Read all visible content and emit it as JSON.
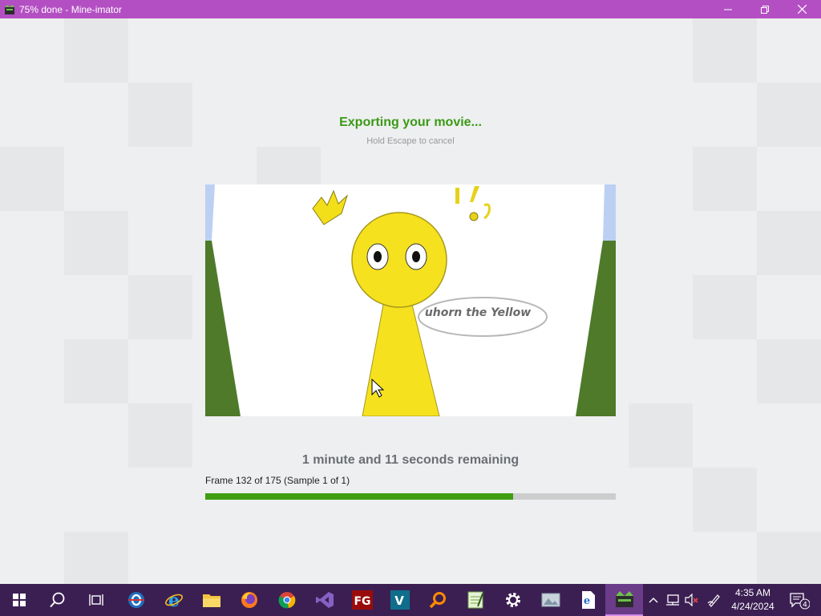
{
  "window": {
    "title": "75% done - Mine-imator",
    "controls": {
      "minimize": "minimize-icon",
      "maximize": "restore-icon",
      "close": "close-icon"
    }
  },
  "export": {
    "heading": "Exporting your movie...",
    "subheading": "Hold Escape to cancel",
    "preview_caption": "uhorn the Yellow",
    "remaining": "1 minute and 11 seconds remaining",
    "frame_status": "Frame 132 of 175 (Sample 1 of 1)",
    "progress": 0.75
  },
  "taskbar": {
    "apps": [
      "windows-start-icon",
      "search-icon",
      "task-view-icon",
      "outlook-icon",
      "internet-explorer-icon",
      "file-explorer-icon",
      "firefox-icon",
      "chrome-icon",
      "visual-studio-icon",
      "fg-app-icon",
      "vegas-icon",
      "search-tool-icon",
      "notepad-icon",
      "settings-icon",
      "photo-viewer-icon",
      "document-icon",
      "mine-imator-icon"
    ],
    "tray_icons": [
      "chevron-up-icon",
      "network-icon",
      "volume-muted-icon",
      "pen-icon"
    ],
    "clock": {
      "time": "4:35 AM",
      "date": "4/24/2024"
    },
    "notification_count": "4",
    "colors": {
      "accent": "#b34fc3",
      "taskbar": "#3b1f52",
      "progress": "#3f9e12",
      "heading": "#3a9a14"
    }
  }
}
